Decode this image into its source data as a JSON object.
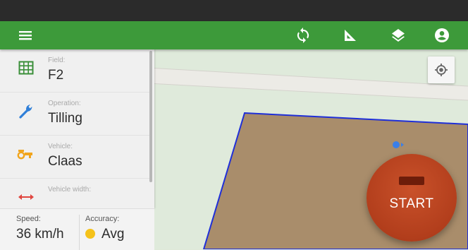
{
  "appbar": {
    "icons": [
      "menu-icon",
      "sync-icon",
      "measure-icon",
      "layers-icon",
      "account-icon"
    ],
    "color": "#3d9a3a"
  },
  "sidebar": {
    "items": [
      {
        "label": "Field:",
        "value": "F2",
        "icon": "grid-icon",
        "icon_color": "#3b8f3a"
      },
      {
        "label": "Operation:",
        "value": "Tilling",
        "icon": "wrench-icon",
        "icon_color": "#2f7fd8"
      },
      {
        "label": "Vehicle:",
        "value": "Claas",
        "icon": "tractor-icon",
        "icon_color": "#f1a51e"
      },
      {
        "label": "Vehicle width:",
        "value": "",
        "icon": "width-arrows-icon",
        "icon_color": "#e0463f"
      }
    ]
  },
  "status": {
    "speed_label": "Speed:",
    "speed_value": "36 km/h",
    "accuracy_label": "Accuracy:",
    "accuracy_value": "Avg",
    "accuracy_color": "#f5c21a"
  },
  "map": {
    "field_color": "#a98d6b",
    "boundary_color": "#1f2fd8",
    "locate_icon": "my-location-icon"
  },
  "start_button": {
    "label": "START",
    "color": "#b23e1c"
  }
}
